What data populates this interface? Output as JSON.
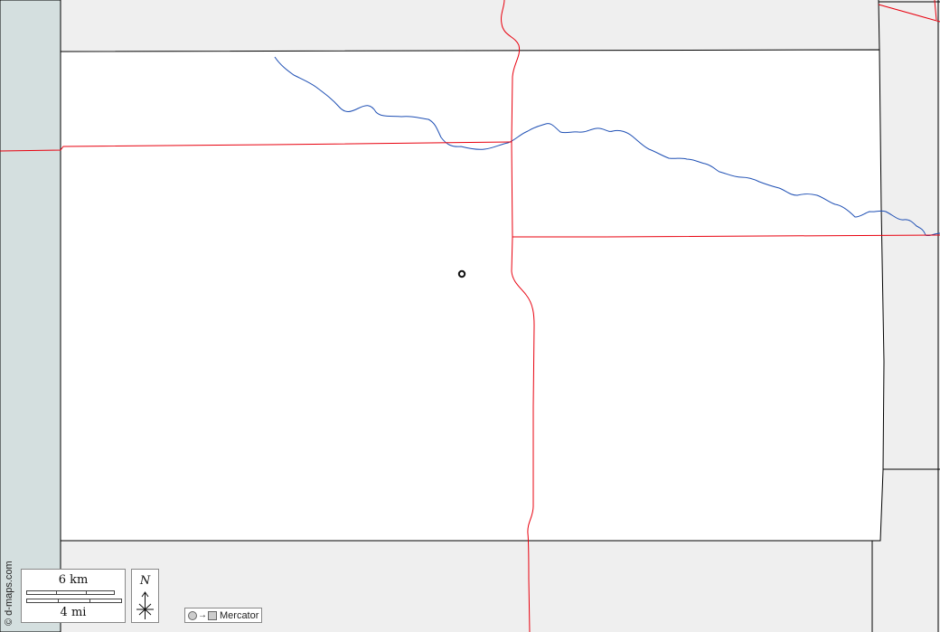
{
  "credit": "© d-maps.com",
  "scale": {
    "km_label": "6 km",
    "mi_label": "4 mi"
  },
  "north": {
    "label": "N"
  },
  "projection": {
    "label": "Mercator",
    "arrow": "→"
  },
  "colors": {
    "sea": "#d4dfdf",
    "outside_land": "#efefef",
    "county_land": "#ffffff",
    "border_line": "#000000",
    "road": "#e8000e",
    "river": "#1e4fb4"
  },
  "map_features": {
    "town_marker": "city-dot",
    "rivers": [
      "river"
    ],
    "roads": [
      "road-horizontal-north",
      "road-vertical-central",
      "road-horizontal-east"
    ]
  }
}
